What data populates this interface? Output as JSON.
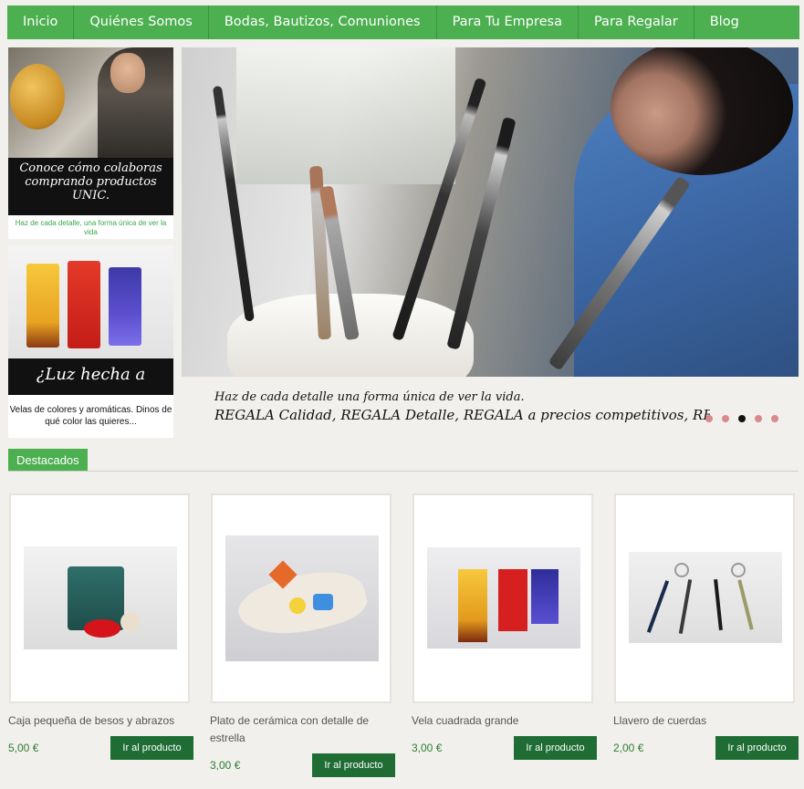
{
  "nav": {
    "items": [
      "Inicio",
      "Quiénes Somos",
      "Bodas, Bautizos, Comuniones",
      "Para Tu Empresa",
      "Para Regalar",
      "Blog"
    ]
  },
  "banners": {
    "colabora_title": "Conoce cómo colaboras comprando productos UNIC.",
    "colabora_sub": "Haz de cada detalle, una forma única de ver la vida",
    "luz_title": "¿Luz hecha a mano?",
    "luz_sub": "Velas de colores y aromáticas. Dinos de qué color las quieres..."
  },
  "hero": {
    "caption_line1": "Haz de cada detalle una forma única de ver la vida.",
    "caption_line2": "REGALA Calidad, REGALA Detalle, REGALA a precios competitivos, REGALA"
  },
  "section": {
    "title": "Destacados"
  },
  "products": [
    {
      "name": "Caja pequeña de besos y abrazos",
      "price": "5,00 €",
      "button": "Ir al producto",
      "icon": "gift-box-image"
    },
    {
      "name": "Plato de cerámica con detalle de estrella",
      "price": "3,00 €",
      "button": "Ir al producto",
      "icon": "ceramic-plate-image"
    },
    {
      "name": "Vela cuadrada grande",
      "price": "3,00 €",
      "button": "Ir al producto",
      "icon": "candles-image"
    },
    {
      "name": "Llavero de cuerdas",
      "price": "2,00 €",
      "button": "Ir al producto",
      "icon": "keychains-image"
    }
  ],
  "colors": {
    "nav_green": "#4caf50",
    "button_green": "#1f6d35",
    "price_green": "#2e7d32",
    "background": "#f1f0ec"
  }
}
